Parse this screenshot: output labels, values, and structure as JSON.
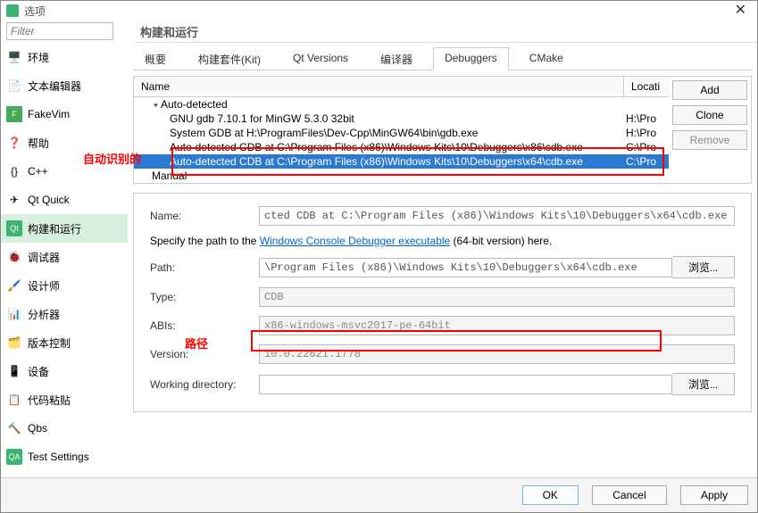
{
  "title": "选项",
  "filter_placeholder": "Filter",
  "page_title": "构建和运行",
  "sidebar": {
    "items": [
      {
        "label": "环境"
      },
      {
        "label": "文本编辑器"
      },
      {
        "label": "FakeVim"
      },
      {
        "label": "帮助"
      },
      {
        "label": "C++"
      },
      {
        "label": "Qt Quick"
      },
      {
        "label": "构建和运行"
      },
      {
        "label": "调试器"
      },
      {
        "label": "设计师"
      },
      {
        "label": "分析器"
      },
      {
        "label": "版本控制"
      },
      {
        "label": "设备"
      },
      {
        "label": "代码粘贴"
      },
      {
        "label": "Qbs"
      },
      {
        "label": "Test Settings"
      }
    ]
  },
  "tabs": [
    "概要",
    "构建套件(Kit)",
    "Qt Versions",
    "编译器",
    "Debuggers",
    "CMake"
  ],
  "table": {
    "headers": {
      "name": "Name",
      "location": "Locati"
    },
    "rows": [
      {
        "level": 1,
        "expand": true,
        "name": "Auto-detected",
        "loc": ""
      },
      {
        "level": 2,
        "name": "GNU gdb 7.10.1 for MinGW 5.3.0 32bit",
        "loc": "H:\\Pro"
      },
      {
        "level": 2,
        "name": "System GDB at H:\\ProgramFiles\\Dev-Cpp\\MinGW64\\bin\\gdb.exe",
        "loc": "H:\\Pro"
      },
      {
        "level": 2,
        "name": "Auto-detected CDB at C:\\Program Files (x86)\\Windows Kits\\10\\Debuggers\\x86\\cdb.exe",
        "loc": "C:\\Pro"
      },
      {
        "level": 2,
        "selected": true,
        "name": "Auto-detected CDB at C:\\Program Files (x86)\\Windows Kits\\10\\Debuggers\\x64\\cdb.exe",
        "loc": "C:\\Pro"
      },
      {
        "level": 1,
        "name": "Manual",
        "loc": ""
      }
    ]
  },
  "buttons": {
    "add": "Add",
    "clone": "Clone",
    "remove": "Remove"
  },
  "details": {
    "name_lbl": "Name:",
    "name_val": "cted CDB at C:\\Program Files (x86)\\Windows Kits\\10\\Debuggers\\x64\\cdb.exe",
    "hint_pre": "Specify the path to the ",
    "hint_link": "Windows Console Debugger executable",
    "hint_post": " (64-bit version) here.",
    "path_lbl": "Path:",
    "path_val": "\\Program Files (x86)\\Windows Kits\\10\\Debuggers\\x64\\cdb.exe",
    "type_lbl": "Type:",
    "type_val": "CDB",
    "abis_lbl": "ABIs:",
    "abis_val": "x86-windows-msvc2017-pe-64bit",
    "version_lbl": "Version:",
    "version_val": "10.0.22621.1778",
    "wd_lbl": "Working directory:",
    "browse": "浏览..."
  },
  "bottom": {
    "ok": "OK",
    "cancel": "Cancel",
    "apply": "Apply"
  },
  "annotations": {
    "auto": "自动识别的",
    "path": "路径"
  }
}
